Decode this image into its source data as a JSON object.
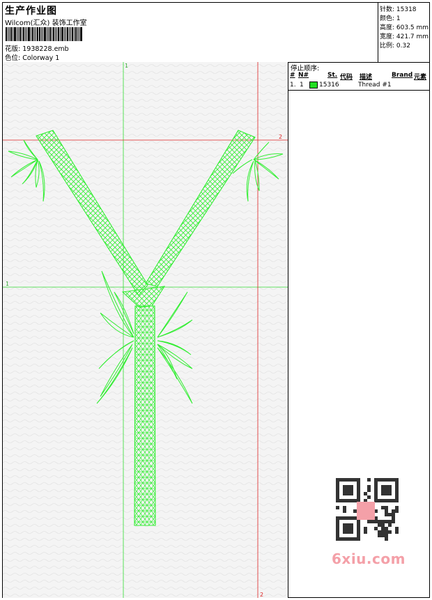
{
  "header": {
    "title": "生产作业图",
    "company": "Wilcom(汇众) 装饰工作室",
    "design_label": "花版:",
    "design_value": "1938228.emb",
    "colorway_label": "色位:",
    "colorway_value": "Colorway 1"
  },
  "stats": {
    "stitches": "针数: 15318",
    "colors": "颜色: 1",
    "height": "高度: 603.5 mm",
    "width": "宽度: 421.7 mm",
    "scale": "比例: 0.32"
  },
  "stop_sequence": {
    "title": "停止顺序:",
    "columns": {
      "hash": "#",
      "n": "N#",
      "st": "St.",
      "code": "代码",
      "desc": "描述",
      "brand": "Brand",
      "element": "元素"
    },
    "rows": [
      {
        "index": "1.",
        "n": "1",
        "color": "#22dd22",
        "code": "15316",
        "desc": "Thread #1"
      }
    ]
  },
  "guides": {
    "v1_label": "1",
    "h1_label": "1",
    "h2_label": "2",
    "v2_label": "2"
  },
  "colors": {
    "thread": "#33ee33",
    "guide_green": "#33dd33",
    "guide_red": "#dd2222"
  },
  "watermark": {
    "text": "6xiu.com"
  }
}
